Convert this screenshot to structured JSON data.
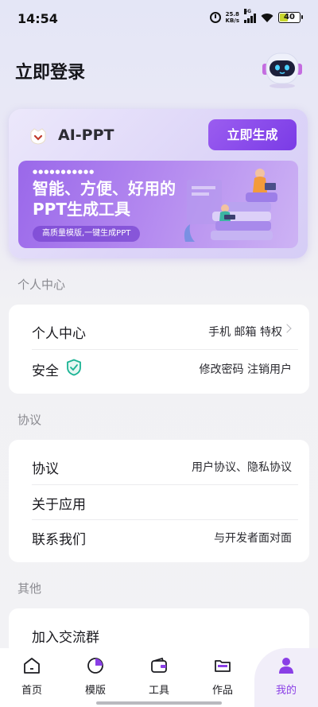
{
  "status_bar": {
    "time": "14:54",
    "net_speed_value": "25.8",
    "net_speed_unit": "KB/s",
    "network": "5G",
    "battery": "40"
  },
  "header": {
    "title": "立即登录",
    "avatar_icon": "robot-avatar-icon"
  },
  "ai_card": {
    "title": "AI-PPT",
    "generate_label": "立即生成",
    "banner": {
      "headline_line1": "智能、方便、好用的",
      "headline_line2": "PPT生成工具",
      "pill": "高质量模版,一键生成PPT"
    }
  },
  "sections": {
    "personal": {
      "label": "个人中心",
      "rows": [
        {
          "title": "个人中心",
          "value": "手机 邮箱 特权"
        },
        {
          "title": "安全",
          "value": "修改密码  注销用户"
        }
      ]
    },
    "agreement": {
      "label": "协议",
      "rows": [
        {
          "title": "协议",
          "value": "用户协议、隐私协议"
        },
        {
          "title": "关于应用",
          "value": ""
        },
        {
          "title": "联系我们",
          "value": "与开发者面对面"
        }
      ]
    },
    "other": {
      "label": "其他",
      "rows": [
        {
          "title": "加入交流群",
          "value": ""
        }
      ]
    }
  },
  "tab_bar": {
    "tabs": [
      {
        "label": "首页",
        "icon": "home-icon"
      },
      {
        "label": "模版",
        "icon": "template-icon"
      },
      {
        "label": "工具",
        "icon": "wallet-tool-icon"
      },
      {
        "label": "作品",
        "icon": "folder-icon"
      },
      {
        "label": "我的",
        "icon": "user-icon"
      }
    ],
    "active_color": "#8a3fe6"
  },
  "colors": {
    "accent": "#8a3fe6",
    "shield": "#1ab394"
  }
}
